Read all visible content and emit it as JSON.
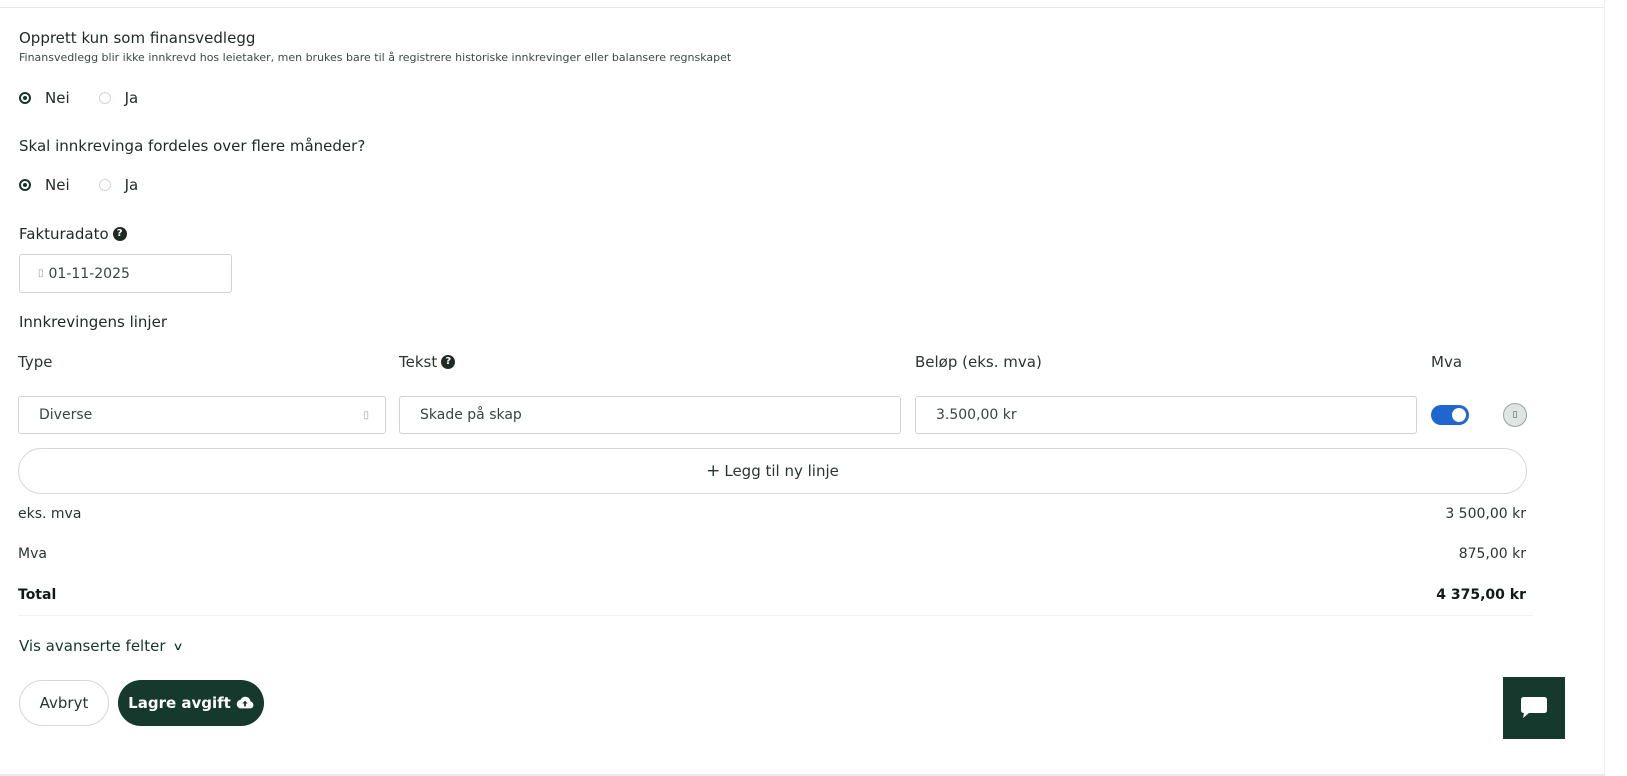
{
  "finance_attachment": {
    "title": "Opprett kun som finansvedlegg",
    "description": "Finansvedlegg blir ikke innkrevd hos leietaker, men brukes bare til å registrere historiske innkrevinger eller balansere regnskapet",
    "option_no": "Nei",
    "option_yes": "Ja",
    "selected": "Nei"
  },
  "spread_months": {
    "title": "Skal innkrevinga fordeles over flere måneder?",
    "option_no": "Nei",
    "option_yes": "Ja",
    "selected": "Nei"
  },
  "invoice_date": {
    "label": "Fakturadato",
    "value": "01-11-2025"
  },
  "lines": {
    "title": "Innkrevingens linjer",
    "headers": {
      "type": "Type",
      "text": "Tekst",
      "amount": "Beløp (eks. mva)",
      "vat": "Mva"
    },
    "rows": [
      {
        "type": "Diverse",
        "text": "Skade på skap",
        "amount": "3.500,00 kr",
        "vat_enabled": true
      }
    ],
    "add_label": "Legg til ny linje"
  },
  "summary": {
    "excl_label": "eks. mva",
    "excl_value": "3 500,00 kr",
    "vat_label": "Mva",
    "vat_value": "875,00 kr",
    "total_label": "Total",
    "total_value": "4 375,00 kr"
  },
  "advanced_label": "Vis avanserte felter",
  "buttons": {
    "cancel": "Avbryt",
    "save": "Lagre avgift"
  },
  "colors": {
    "primary": "#15392c",
    "toggle_on": "#1f66d1"
  }
}
